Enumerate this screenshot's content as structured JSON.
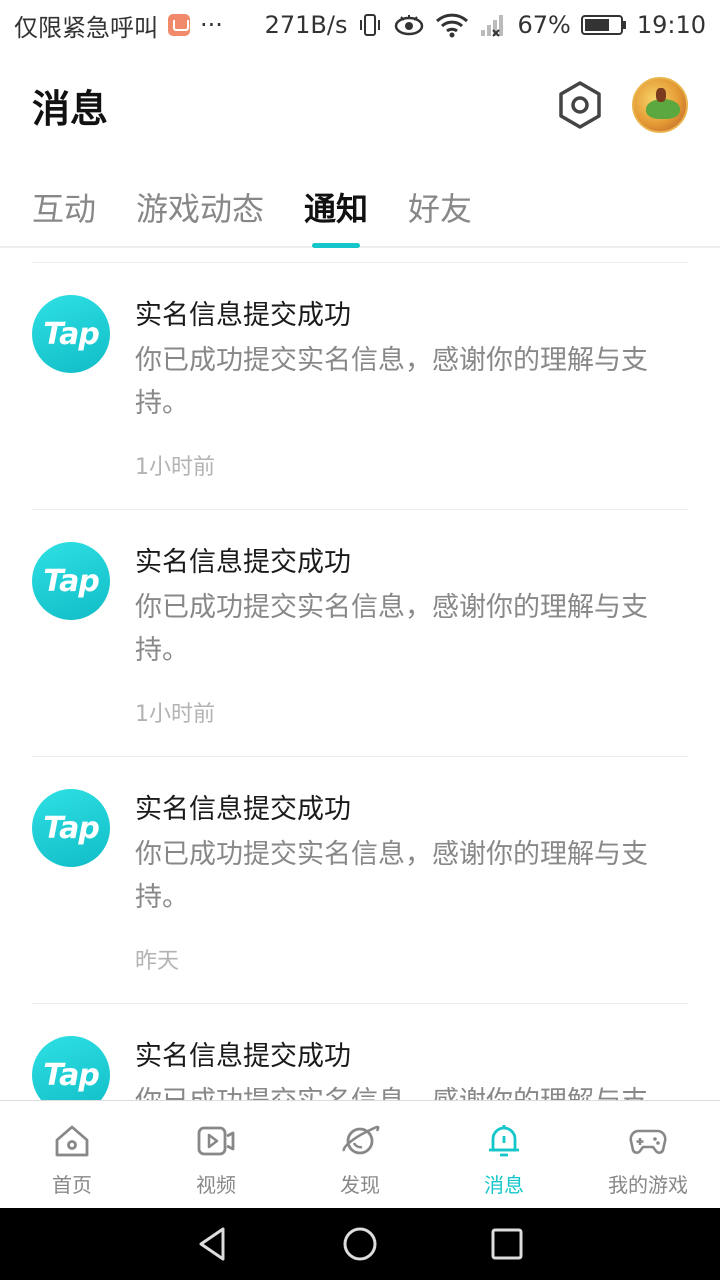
{
  "status_bar": {
    "carrier_text": "仅限紧急呼叫",
    "more": "···",
    "speed": "271B/s",
    "battery": "67%",
    "time": "19:10"
  },
  "header": {
    "title": "消息"
  },
  "tabs": [
    {
      "label": "互动"
    },
    {
      "label": "游戏动态"
    },
    {
      "label": "通知",
      "active": true
    },
    {
      "label": "好友"
    }
  ],
  "notifications": [
    {
      "logo": "Tap",
      "title": "实名信息提交成功",
      "desc": "你已成功提交实名信息，感谢你的理解与支持。",
      "time": "1小时前"
    },
    {
      "logo": "Tap",
      "title": "实名信息提交成功",
      "desc": "你已成功提交实名信息，感谢你的理解与支持。",
      "time": "1小时前"
    },
    {
      "logo": "Tap",
      "title": "实名信息提交成功",
      "desc": "你已成功提交实名信息，感谢你的理解与支持。",
      "time": "昨天"
    },
    {
      "logo": "Tap",
      "title": "实名信息提交成功",
      "desc": "你已成功提交实名信息，感谢你的理解与支持。",
      "time": ""
    }
  ],
  "bottom_nav": [
    {
      "label": "首页",
      "icon": "home-icon"
    },
    {
      "label": "视频",
      "icon": "video-icon"
    },
    {
      "label": "发现",
      "icon": "planet-icon"
    },
    {
      "label": "消息",
      "icon": "bell-icon",
      "active": true
    },
    {
      "label": "我的游戏",
      "icon": "gamepad-icon"
    }
  ],
  "colors": {
    "accent": "#14c6c9",
    "text_primary": "#1a1a1a",
    "text_secondary": "#888888"
  }
}
